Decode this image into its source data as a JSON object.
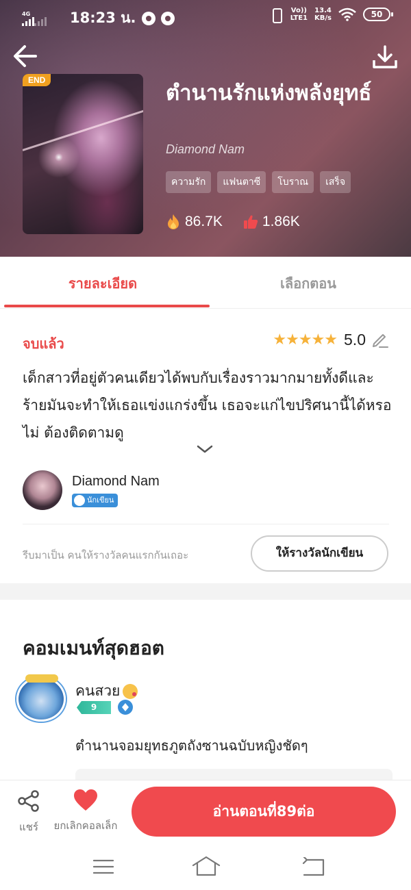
{
  "status_bar": {
    "network": "4G",
    "time": "18:23 น.",
    "volte_line1": "Vo))",
    "volte_line2": "LTE1",
    "speed_value": "13.4",
    "speed_unit": "KB/s",
    "battery": "50"
  },
  "book": {
    "badge": "END",
    "title": "ตำนานรักแห่งพลังยุทธ์",
    "author": "Diamond Nam",
    "tags": [
      "ความรัก",
      "แฟนตาซี",
      "โบราณ",
      "เสร็จ"
    ],
    "views": "86.7K",
    "likes": "1.86K"
  },
  "tabs": {
    "details": "รายละเอียด",
    "chapters": "เลือกตอน"
  },
  "details": {
    "status": "จบแล้ว",
    "rating_stars": "★★★★★",
    "rating_value": "5.0",
    "description": "เด็กสาวที่อยู่ตัวคนเดียวได้พบกับเรื่องราวมากมายทั้งดีและร้ายมันจะทำให้เธอแข่งแกร่งขึ้น เธอจะแก่ไขปริศนานี้ได้หรอไม่ ต้องติดตามดู",
    "author_name": "Diamond Nam",
    "author_badge": "นักเขียน",
    "reward_prompt": "รีบมาเป็น คนให้รางวัลคนแรกกันเถอะ",
    "reward_button": "ให้รางวัลนักเขียน"
  },
  "comments": {
    "section_title": "คอมเมนท์สุดฮอต",
    "items": [
      {
        "user": "คนสวย",
        "level": "9",
        "text": "ตำนานจอมยุทธภูตถังซานฉบับหญิงชัดๆ"
      }
    ]
  },
  "actions": {
    "share": "แชร์",
    "unfavorite": "ยกเลิกคอลเล็ก",
    "read": "อ่านตอนที่89ต่อ"
  },
  "colors": {
    "accent": "#f04a4e",
    "star": "#f6b23a",
    "writer_badge": "#3a8fd9"
  },
  "icons": {
    "back": "arrow-left-icon",
    "download": "download-icon",
    "views": "flame-icon",
    "likes": "thumbs-up-icon",
    "edit": "pencil-icon",
    "expand": "chevron-down-icon",
    "share": "share-icon",
    "favorite": "heart-icon"
  }
}
